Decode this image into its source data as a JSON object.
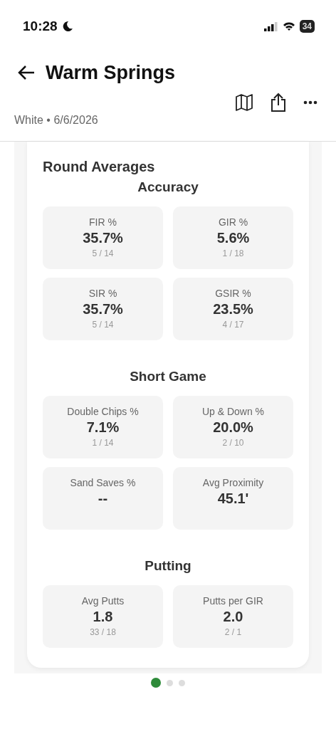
{
  "status_bar": {
    "time": "10:28",
    "battery": "34"
  },
  "header": {
    "title": "Warm Springs",
    "subtitle": "White • 6/6/2026"
  },
  "card": {
    "title": "Round Averages",
    "sections": [
      {
        "title": "Accuracy",
        "stats": [
          {
            "label": "FIR %",
            "value": "35.7%",
            "detail": "5 / 14"
          },
          {
            "label": "GIR %",
            "value": "5.6%",
            "detail": "1 / 18"
          },
          {
            "label": "SIR %",
            "value": "35.7%",
            "detail": "5 / 14"
          },
          {
            "label": "GSIR %",
            "value": "23.5%",
            "detail": "4 / 17"
          }
        ]
      },
      {
        "title": "Short Game",
        "stats": [
          {
            "label": "Double Chips %",
            "value": "7.1%",
            "detail": "1 / 14"
          },
          {
            "label": "Up & Down %",
            "value": "20.0%",
            "detail": "2 / 10"
          },
          {
            "label": "Sand Saves %",
            "value": "--"
          },
          {
            "label": "Avg Proximity",
            "value": "45.1'"
          }
        ]
      },
      {
        "title": "Putting",
        "stats": [
          {
            "label": "Avg Putts",
            "value": "1.8",
            "detail": "33 / 18"
          },
          {
            "label": "Putts per GIR",
            "value": "2.0",
            "detail": "2 / 1"
          }
        ]
      }
    ]
  },
  "pager": [
    {
      "selected": true
    },
    {
      "selected": false
    },
    {
      "selected": false
    }
  ]
}
